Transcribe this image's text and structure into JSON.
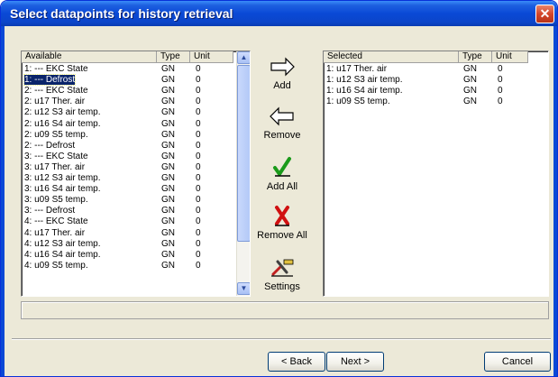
{
  "window": {
    "title": "Select datapoints for history retrieval",
    "close_glyph": "✕"
  },
  "available": {
    "headers": {
      "name": "Available",
      "type": "Type",
      "unit": "Unit"
    },
    "selected_index": 1,
    "rows": [
      {
        "name": "1: --- EKC State",
        "type": "GN",
        "unit": "0"
      },
      {
        "name": "1: --- Defrost",
        "type": "GN",
        "unit": "0"
      },
      {
        "name": "2: --- EKC State",
        "type": "GN",
        "unit": "0"
      },
      {
        "name": "2: u17 Ther. air",
        "type": "GN",
        "unit": "0"
      },
      {
        "name": "2: u12 S3 air temp.",
        "type": "GN",
        "unit": "0"
      },
      {
        "name": "2: u16 S4 air temp.",
        "type": "GN",
        "unit": "0"
      },
      {
        "name": "2: u09 S5 temp.",
        "type": "GN",
        "unit": "0"
      },
      {
        "name": "2: --- Defrost",
        "type": "GN",
        "unit": "0"
      },
      {
        "name": "3: --- EKC State",
        "type": "GN",
        "unit": "0"
      },
      {
        "name": "3: u17 Ther. air",
        "type": "GN",
        "unit": "0"
      },
      {
        "name": "3: u12 S3 air temp.",
        "type": "GN",
        "unit": "0"
      },
      {
        "name": "3: u16 S4 air temp.",
        "type": "GN",
        "unit": "0"
      },
      {
        "name": "3: u09 S5 temp.",
        "type": "GN",
        "unit": "0"
      },
      {
        "name": "3: --- Defrost",
        "type": "GN",
        "unit": "0"
      },
      {
        "name": "4: --- EKC State",
        "type": "GN",
        "unit": "0"
      },
      {
        "name": "4: u17 Ther. air",
        "type": "GN",
        "unit": "0"
      },
      {
        "name": "4: u12 S3 air temp.",
        "type": "GN",
        "unit": "0"
      },
      {
        "name": "4: u16 S4 air temp.",
        "type": "GN",
        "unit": "0"
      },
      {
        "name": "4: u09 S5 temp.",
        "type": "GN",
        "unit": "0"
      }
    ]
  },
  "selected": {
    "headers": {
      "name": "Selected",
      "type": "Type",
      "unit": "Unit"
    },
    "rows": [
      {
        "name": "1: u17 Ther. air",
        "type": "GN",
        "unit": "0"
      },
      {
        "name": "1: u12 S3 air temp.",
        "type": "GN",
        "unit": "0"
      },
      {
        "name": "1: u16 S4 air temp.",
        "type": "GN",
        "unit": "0"
      },
      {
        "name": "1: u09 S5 temp.",
        "type": "GN",
        "unit": "0"
      }
    ]
  },
  "actions": {
    "add": {
      "label": "Add",
      "icon": "arrow-right-icon"
    },
    "remove": {
      "label": "Remove",
      "icon": "arrow-left-icon"
    },
    "add_all": {
      "label": "Add All",
      "icon": "check-mark-icon"
    },
    "remove_all": {
      "label": "Remove All",
      "icon": "x-mark-icon"
    },
    "settings": {
      "label": "Settings",
      "icon": "tools-icon"
    }
  },
  "footer": {
    "back_label": "< Back",
    "next_label": "Next >",
    "cancel_label": "Cancel"
  },
  "scroll_arrows": {
    "up": "▲",
    "down": "▼"
  },
  "colors": {
    "titlebar": "#0a49d6",
    "selection": "#0a246a",
    "dialog_bg": "#ece9d8"
  }
}
